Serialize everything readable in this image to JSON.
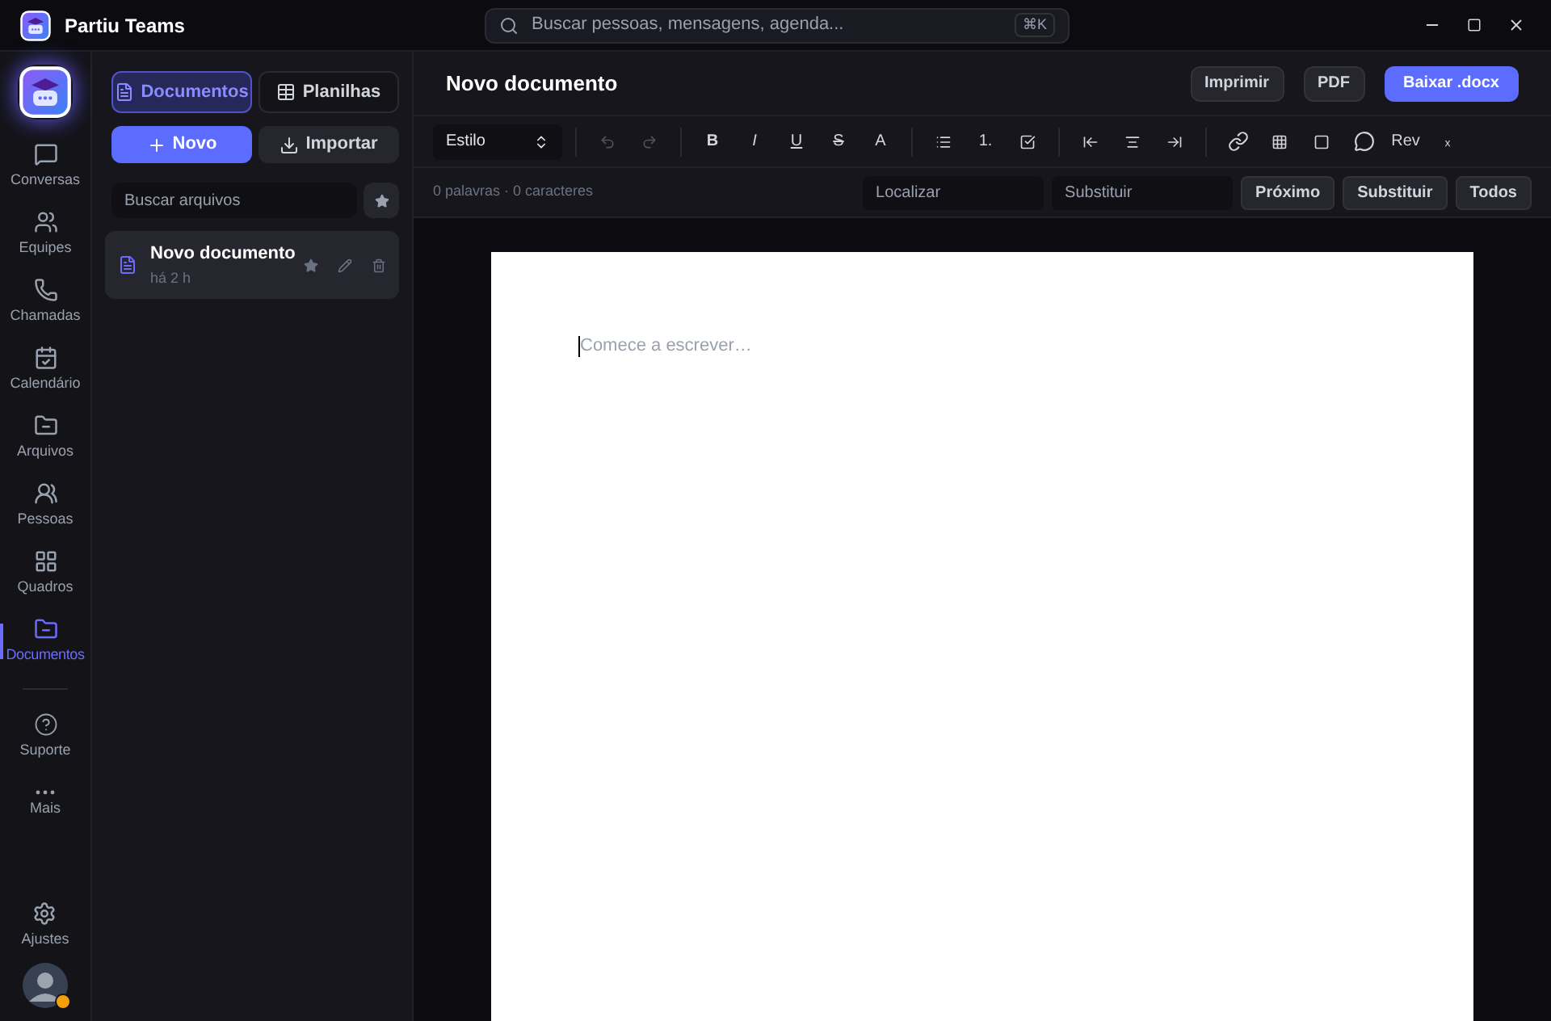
{
  "app": {
    "title": "Partiu Teams"
  },
  "search": {
    "placeholder": "Buscar pessoas, mensagens, agenda...",
    "shortcut": "⌘K"
  },
  "nav": [
    {
      "label": "Conversas",
      "selected": false
    },
    {
      "label": "Equipes",
      "selected": false
    },
    {
      "label": "Chamadas",
      "selected": false
    },
    {
      "label": "Calendário",
      "selected": false
    },
    {
      "label": "Arquivos",
      "selected": false
    },
    {
      "label": "Pessoas",
      "selected": false
    },
    {
      "label": "Quadros",
      "selected": false
    },
    {
      "label": "Documentos",
      "selected": true
    }
  ],
  "nav_extra": [
    {
      "label": "Suporte"
    },
    {
      "label": "Mais"
    }
  ],
  "settings": {
    "label": "Ajustes"
  },
  "tabs": [
    {
      "label": "Documentos",
      "selected": true
    },
    {
      "label": "Planilhas",
      "selected": false
    }
  ],
  "new_button": "Novo",
  "import_button": "Importar",
  "file_search": {
    "placeholder": "Buscar arquivos"
  },
  "files": [
    {
      "name": "Novo documento",
      "time": "há 2 h",
      "selected": true
    }
  ],
  "editor": {
    "title": "Novo documento",
    "print": "Imprimir",
    "pdf": "PDF",
    "download": "Baixar .docx",
    "style_select": "Estilo",
    "toolbar": [
      {
        "kind": "icon",
        "disabled": true
      },
      {
        "kind": "icon",
        "disabled": true
      },
      {
        "kind": "sep"
      },
      {
        "kind": "text",
        "text": "B",
        "disabled": false
      },
      {
        "kind": "text",
        "text": "I",
        "disabled": false
      },
      {
        "kind": "text",
        "text": "U",
        "disabled": false
      },
      {
        "kind": "text",
        "text": "S",
        "disabled": false
      },
      {
        "kind": "text",
        "text": "A",
        "disabled": false
      },
      {
        "kind": "sep"
      },
      {
        "kind": "icon",
        "disabled": false
      },
      {
        "kind": "text",
        "text": "1.",
        "disabled": false
      },
      {
        "kind": "icon",
        "disabled": false
      },
      {
        "kind": "sep"
      },
      {
        "kind": "icon",
        "disabled": false
      },
      {
        "kind": "icon",
        "disabled": false
      },
      {
        "kind": "icon",
        "disabled": false
      },
      {
        "kind": "sep"
      },
      {
        "kind": "icon",
        "disabled": false
      },
      {
        "kind": "icon",
        "disabled": false
      },
      {
        "kind": "icon",
        "disabled": false
      },
      {
        "kind": "icon",
        "disabled": false
      },
      {
        "kind": "text",
        "text": "Rev",
        "disabled": false
      },
      {
        "kind": "text",
        "text": "ₓ",
        "disabled": false
      }
    ],
    "counts": "0 palavras · 0 caracteres",
    "find_placeholder": "Localizar",
    "replace_placeholder": "Substituir",
    "find_buttons": [
      "Próximo",
      "Substituir",
      "Todos"
    ],
    "page_placeholder": "Comece a escrever…"
  }
}
